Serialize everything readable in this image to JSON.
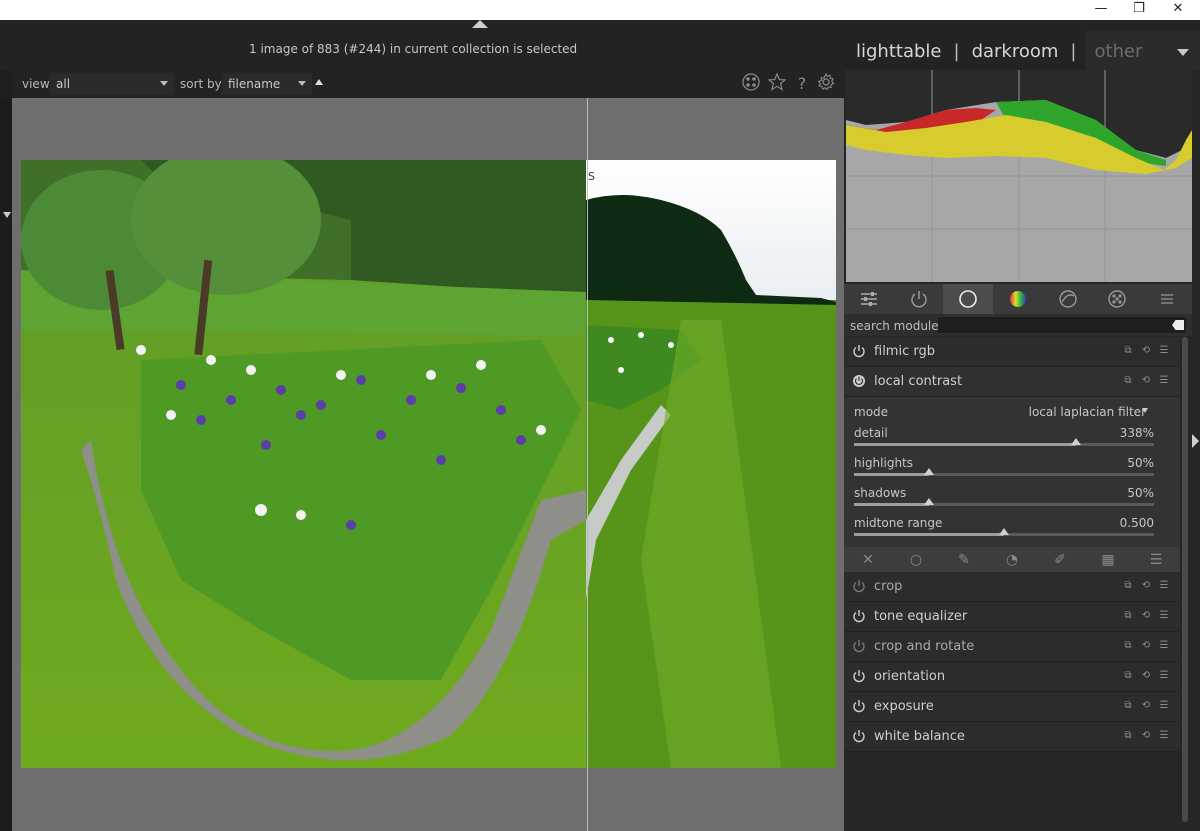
{
  "window": {
    "minimize_glyph": "—",
    "restore_glyph": "❐",
    "close_glyph": "✕"
  },
  "header": {
    "status": "1 image of 883 (#244) in current collection is selected",
    "views": {
      "lighttable": "lighttable",
      "darkroom": "darkroom",
      "other": "other",
      "separator": "|"
    }
  },
  "toolbar": {
    "view_label": "view",
    "view_value": "all",
    "sort_label": "sort by",
    "sort_value": "filename",
    "icons": [
      "grouping-icon",
      "star-icon",
      "help-icon",
      "gear-icon"
    ]
  },
  "center": {
    "split_marker": "S"
  },
  "right_panel": {
    "module_group_icons": [
      "quick-access-icon",
      "active-modules-icon",
      "base-group-icon",
      "color-group-icon",
      "correct-group-icon",
      "effect-group-icon",
      "presets-menu-icon"
    ],
    "search_label": "search module",
    "search_value": "",
    "modules_top": [
      {
        "name": "filmic rgb",
        "enabled": true
      },
      {
        "name": "local contrast",
        "enabled": true,
        "expanded": true
      }
    ],
    "local_contrast": {
      "mode_label": "mode",
      "mode_value": "local laplacian filter",
      "params": [
        {
          "label": "detail",
          "value": "338%",
          "level": 0.74
        },
        {
          "label": "highlights",
          "value": "50%",
          "level": 0.25
        },
        {
          "label": "shadows",
          "value": "50%",
          "level": 0.25
        },
        {
          "label": "midtone range",
          "value": "0.500",
          "level": 0.5
        }
      ]
    },
    "blend_icons": [
      "off-blend-icon",
      "uniform-blend-icon",
      "drawn-mask-icon",
      "parametric-mask-icon",
      "drawn-parametric-icon",
      "raster-mask-icon",
      "blend-menu-icon"
    ],
    "modules_bottom": [
      {
        "name": "crop",
        "enabled": false
      },
      {
        "name": "tone equalizer",
        "enabled": true
      },
      {
        "name": "crop and rotate",
        "enabled": false
      },
      {
        "name": "orientation",
        "enabled": true
      },
      {
        "name": "exposure",
        "enabled": true
      },
      {
        "name": "white balance",
        "enabled": true
      }
    ]
  },
  "colors": {
    "panel_bg": "#262626",
    "image_bg": "#6e6e6e",
    "text": "#cfcfcf",
    "histogram_red": "#c8282a",
    "histogram_green": "#2fa52c",
    "histogram_yellow": "#d8cb2e"
  }
}
